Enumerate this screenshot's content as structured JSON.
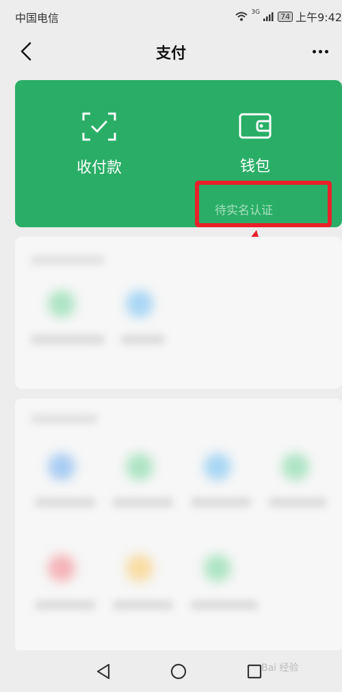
{
  "status_bar": {
    "carrier": "中国电信",
    "network": "3G",
    "battery": "74",
    "time": "上午9:42"
  },
  "nav": {
    "title": "支付"
  },
  "wallet_card": {
    "scan_label": "收付款",
    "wallet_label": "钱包",
    "wallet_status": "待实名认证",
    "accent_color": "#2aae67"
  },
  "annotation": {
    "highlight_color": "#e8202a"
  },
  "watermark": {
    "text": "Bai 经验"
  }
}
